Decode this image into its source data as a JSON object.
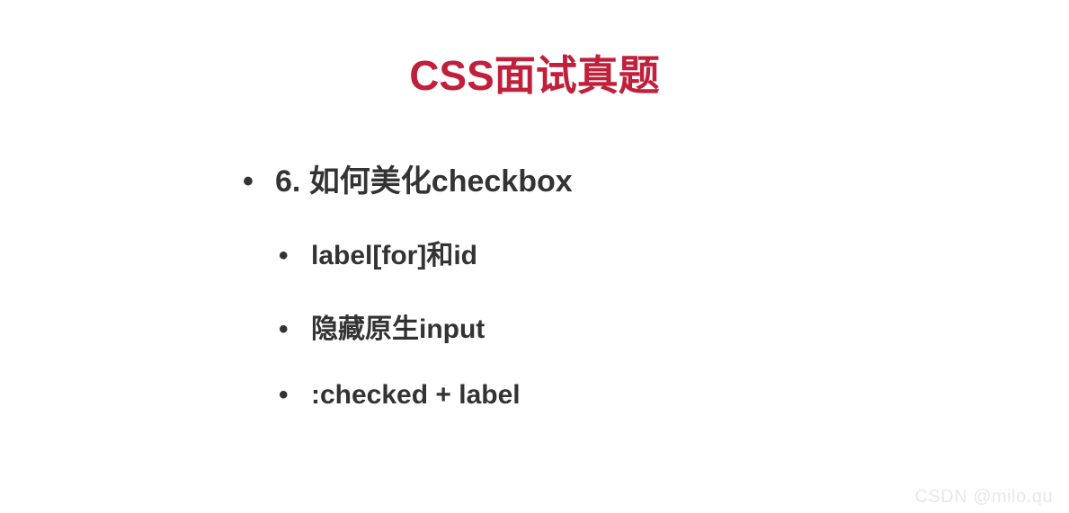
{
  "title": "CSS面试真题",
  "mainItem": "6. 如何美化checkbox",
  "subItems": [
    "label[for]和id",
    "隐藏原生input",
    ":checked + label"
  ],
  "watermark": "CSDN @milo.qu"
}
